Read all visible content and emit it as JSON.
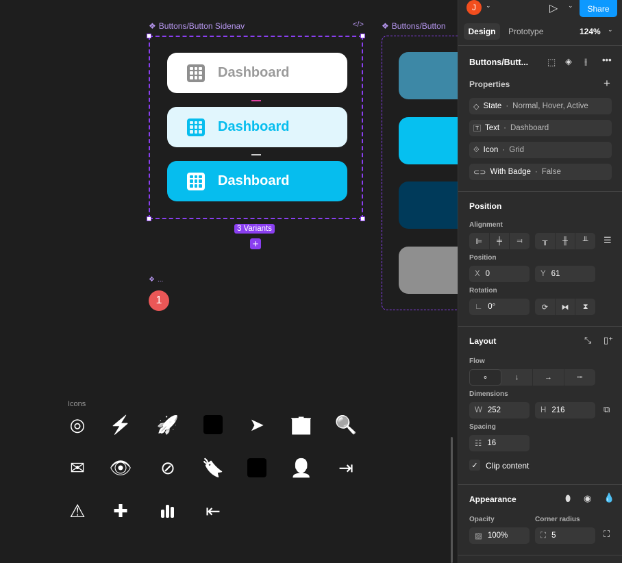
{
  "canvas": {
    "frame1": {
      "label": "Buttons/Button Sidenav",
      "variants_badge": "3 Variants",
      "buttons": [
        {
          "state": "Normal",
          "text": "Dashboard",
          "bg": "#ffffff",
          "fg": "#9a9a9a"
        },
        {
          "state": "Hover",
          "text": "Dashboard",
          "bg": "#e1f6fd",
          "fg": "#06bdee"
        },
        {
          "state": "Active",
          "text": "Dashboard",
          "bg": "#06bdee",
          "fg": "#ffffff"
        }
      ]
    },
    "frame2": {
      "label": "Buttons/Button",
      "buttons": [
        {
          "bg": "#3d88a6"
        },
        {
          "bg": "#06c0f0"
        },
        {
          "bg": "#003a5a"
        },
        {
          "bg": "#8f8f8f"
        }
      ]
    },
    "component_stub": "...",
    "comment_badge": "1",
    "icons_label": "Icons",
    "icons": [
      "target-icon",
      "bolt-icon",
      "rocket-icon",
      "grid-icon",
      "paper-plane-icon",
      "building-icon",
      "search-icon",
      "envelope-icon",
      "eye-icon",
      "eye-slash-icon",
      "bookmark-icon",
      "factory-icon",
      "user-tag-icon",
      "sign-out-icon",
      "warning-icon",
      "puzzle-icon",
      "bar-chart-icon",
      "sign-in-icon"
    ]
  },
  "panel": {
    "avatar": "J",
    "share": "Share",
    "tabs": [
      "Design",
      "Prototype"
    ],
    "zoom": "124%",
    "component_name": "Buttons/Butt...",
    "properties_title": "Properties",
    "properties": [
      {
        "name": "State",
        "value": "Normal, Hover, Active"
      },
      {
        "name": "Text",
        "value": "Dashboard"
      },
      {
        "name": "Icon",
        "value": "Grid"
      },
      {
        "name": "With Badge",
        "value": "False"
      }
    ],
    "position_title": "Position",
    "alignment_label": "Alignment",
    "position_label": "Position",
    "x_label": "X",
    "x": "0",
    "y_label": "Y",
    "y": "61",
    "rotation_label": "Rotation",
    "rotation": "0°",
    "layout_title": "Layout",
    "flow_label": "Flow",
    "dimensions_label": "Dimensions",
    "w_label": "W",
    "w": "252",
    "h_label": "H",
    "h": "216",
    "spacing_label": "Spacing",
    "spacing": "16",
    "clip_content": "Clip content",
    "appearance_title": "Appearance",
    "opacity_label": "Opacity",
    "opacity": "100%",
    "radius_label": "Corner radius",
    "radius": "5"
  }
}
